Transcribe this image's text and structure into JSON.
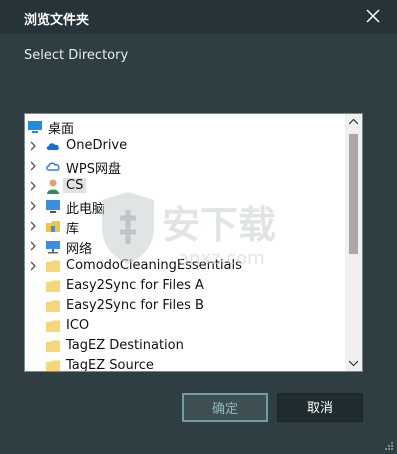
{
  "window": {
    "title": "浏览文件夹"
  },
  "dialog": {
    "subtitle": "Select Directory"
  },
  "tree": {
    "items": [
      {
        "label": "桌面",
        "icon": "desktop-icon",
        "level": 0,
        "expander": false
      },
      {
        "label": "OneDrive",
        "icon": "cloud-icon",
        "level": 1,
        "expander": true
      },
      {
        "label": "WPS网盘",
        "icon": "cloud-outline-icon",
        "level": 1,
        "expander": true
      },
      {
        "label": "CS",
        "icon": "user-icon",
        "level": 1,
        "expander": true,
        "selected": true
      },
      {
        "label": "此电脑",
        "icon": "computer-icon",
        "level": 1,
        "expander": true
      },
      {
        "label": "库",
        "icon": "library-icon",
        "level": 1,
        "expander": true
      },
      {
        "label": "网络",
        "icon": "network-icon",
        "level": 1,
        "expander": true
      },
      {
        "label": "ComodoCleaningEssentials",
        "icon": "folder-icon",
        "level": 1,
        "expander": true
      },
      {
        "label": "Easy2Sync for Files A",
        "icon": "folder-icon",
        "level": 1,
        "expander": false
      },
      {
        "label": "Easy2Sync for Files B",
        "icon": "folder-icon",
        "level": 1,
        "expander": false
      },
      {
        "label": "ICO",
        "icon": "folder-icon",
        "level": 1,
        "expander": false
      },
      {
        "label": "TagEZ Destination",
        "icon": "folder-icon",
        "level": 1,
        "expander": false
      },
      {
        "label": "TagEZ Source",
        "icon": "folder-icon",
        "level": 1,
        "expander": false
      }
    ]
  },
  "buttons": {
    "ok": "确定",
    "cancel": "取消"
  },
  "watermark": {
    "text": "安下载",
    "sub": "anxz.com"
  },
  "colors": {
    "background": "#2e3e43",
    "titlebar": "#263439",
    "ok_border": "#6f9ea0",
    "selection": "#e2e2e2"
  }
}
